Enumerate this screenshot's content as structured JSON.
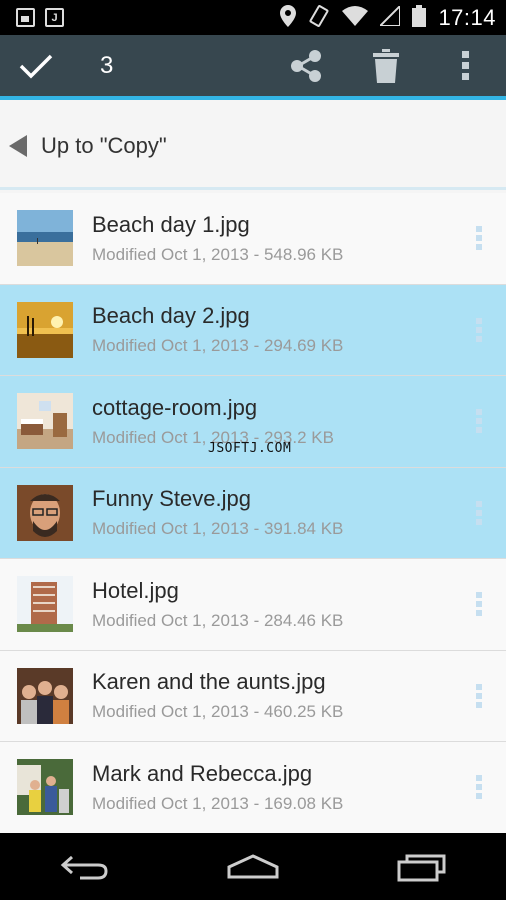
{
  "status_bar": {
    "time": "17:14"
  },
  "action_bar": {
    "selected_count": "3"
  },
  "up_row": {
    "label": "Up to \"Copy\""
  },
  "files": [
    {
      "name": "Beach day 1.jpg",
      "meta": "Modified Oct 1, 2013 - 548.96 KB",
      "selected": false
    },
    {
      "name": "Beach day 2.jpg",
      "meta": "Modified Oct 1, 2013 - 294.69 KB",
      "selected": true
    },
    {
      "name": "cottage-room.jpg",
      "meta": "Modified Oct 1, 2013 - 293.2 KB",
      "selected": true
    },
    {
      "name": "Funny Steve.jpg",
      "meta": "Modified Oct 1, 2013 - 391.84 KB",
      "selected": true
    },
    {
      "name": "Hotel.jpg",
      "meta": "Modified Oct 1, 2013 - 284.46 KB",
      "selected": false
    },
    {
      "name": "Karen and the aunts.jpg",
      "meta": "Modified Oct 1, 2013 - 460.25 KB",
      "selected": false
    },
    {
      "name": "Mark and Rebecca.jpg",
      "meta": "Modified Oct 1, 2013 - 169.08 KB",
      "selected": false
    }
  ],
  "watermark": "JSOFTJ.COM",
  "colors": {
    "action_bar": "#37474f",
    "accent": "#33b5e5",
    "selected_row": "#ace1f5"
  }
}
